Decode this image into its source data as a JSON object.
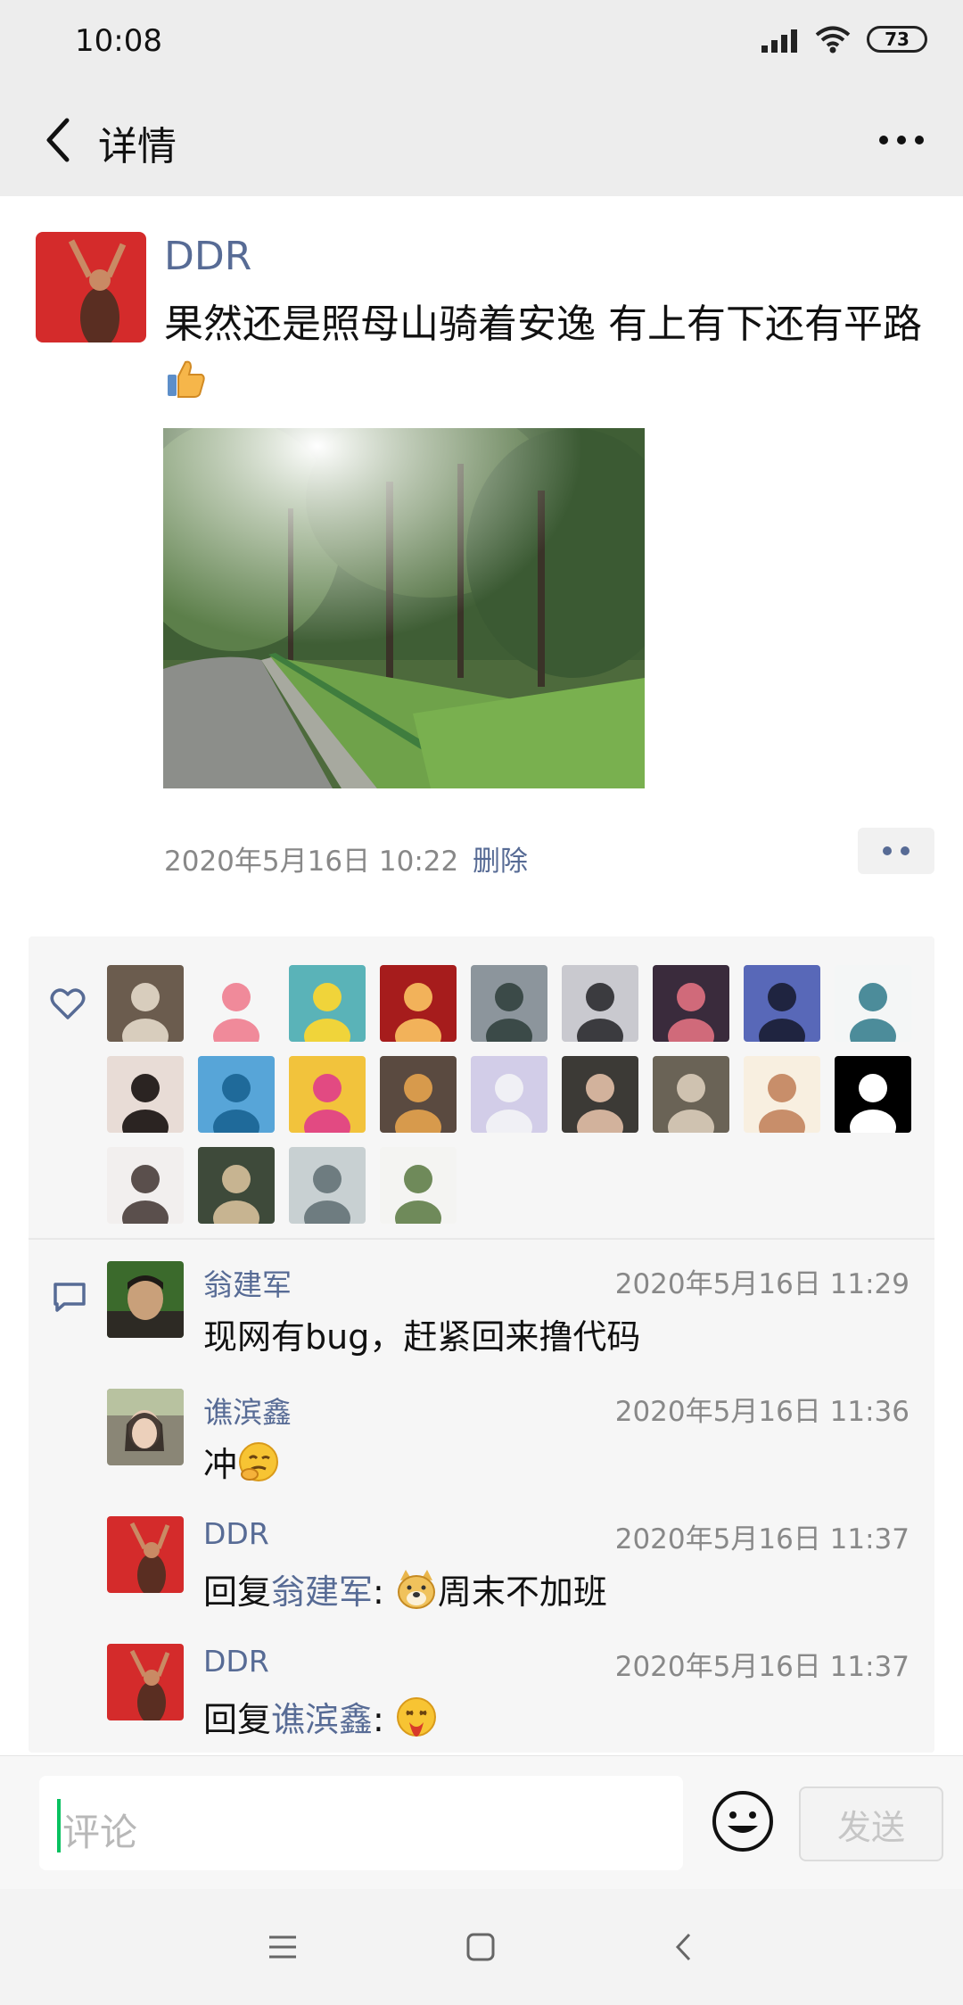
{
  "status_bar": {
    "time": "10:08",
    "battery": "73"
  },
  "header": {
    "title": "详情"
  },
  "post": {
    "author": "DDR",
    "text": "果然还是照母山骑着安逸  有上有下还有平路",
    "time": "2020年5月16日 10:22",
    "delete_label": "删除"
  },
  "likes": {
    "avatars": [
      {
        "colors": [
          "#6b5c4e",
          "#d8cdbd"
        ]
      },
      {
        "colors": [
          "#f6f6f6",
          "#f08a9a"
        ]
      },
      {
        "colors": [
          "#5ab3b8",
          "#f0d43a"
        ]
      },
      {
        "colors": [
          "#a61c1c",
          "#f2b25a"
        ]
      },
      {
        "colors": [
          "#8c959c",
          "#3b4a48"
        ]
      },
      {
        "colors": [
          "#c9c9cf",
          "#3b3b3f"
        ]
      },
      {
        "colors": [
          "#3a2b3c",
          "#d06a7a"
        ]
      },
      {
        "colors": [
          "#5868b8",
          "#1f2440"
        ]
      },
      {
        "colors": [
          "#f4f6f6",
          "#4c8c9a"
        ]
      },
      {
        "colors": [
          "#e8dcd6",
          "#2b2422"
        ]
      },
      {
        "colors": [
          "#57a5d8",
          "#1f6a9a"
        ]
      },
      {
        "colors": [
          "#f2c33c",
          "#e24a82"
        ]
      },
      {
        "colors": [
          "#5a4a40",
          "#d79a4c"
        ]
      },
      {
        "colors": [
          "#d2cde8",
          "#f0f0f5"
        ]
      },
      {
        "colors": [
          "#3c3a36",
          "#d2b29c"
        ]
      },
      {
        "colors": [
          "#6a6356",
          "#cfc2b0"
        ]
      },
      {
        "colors": [
          "#f8efe0",
          "#c88e6a"
        ]
      },
      {
        "colors": [
          "#000000",
          "#ffffff"
        ]
      },
      {
        "colors": [
          "#f2efee",
          "#5a4f4c"
        ]
      },
      {
        "colors": [
          "#3e4a3a",
          "#c7b491"
        ]
      },
      {
        "colors": [
          "#c8d0d2",
          "#6e7c80"
        ]
      },
      {
        "colors": [
          "#f4f4f2",
          "#6f8a5a"
        ]
      }
    ]
  },
  "comments": [
    {
      "name": "翁建军",
      "time": "2020年5月16日 11:29",
      "text": "现网有bug，赶紧回来撸代码",
      "colors": [
        "#3b6a2c",
        "#c9a07a"
      ]
    },
    {
      "name": "谯滨鑫",
      "time": "2020年5月16日 11:36",
      "text": "冲",
      "emoji": "thinking-face",
      "colors": [
        "#6b6659",
        "#e6c9b4"
      ]
    },
    {
      "name": "DDR",
      "time": "2020年5月16日 11:37",
      "prefix": "回复",
      "reply_to": "翁建军",
      "sep": ": ",
      "text": "周末不加班",
      "emoji": "doge",
      "colors": [
        "#d42b2b",
        "#6b3b2b"
      ]
    },
    {
      "name": "DDR",
      "time": "2020年5月16日 11:37",
      "prefix": "回复",
      "reply_to": "谯滨鑫",
      "sep": ": ",
      "text": "",
      "emoji": "vomit-face",
      "colors": [
        "#d42b2b",
        "#6b3b2b"
      ]
    }
  ],
  "input": {
    "placeholder": "评论",
    "send_label": "发送"
  },
  "icons": {
    "back": "back-arrow-icon",
    "more": "more-dots-icon",
    "heart": "heart-icon",
    "comment": "comment-bubble-icon",
    "emoji": "smiley-icon",
    "thumbs_up": "thumbs-up-icon"
  },
  "colors": {
    "link": "#576b95",
    "accent": "#07c160",
    "header_bg": "#ededed"
  }
}
